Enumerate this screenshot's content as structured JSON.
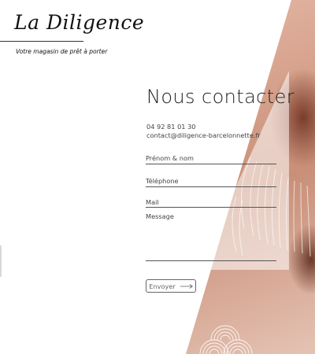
{
  "brand": {
    "logo_text": "La Diligence",
    "tagline": "Votre magasin de prêt à porter"
  },
  "contact": {
    "title": "Nous contacter",
    "phone": "04 92 81 01 30",
    "email": "contact@diligence-barcelonnette.fr"
  },
  "form": {
    "name_label": "Prénom & nom",
    "phone_label": "Téléphone",
    "mail_label": "Mail",
    "message_label": "Message",
    "submit_label": "Envoyer"
  },
  "icons": {
    "submit_icon": "arrow-right-icon"
  }
}
